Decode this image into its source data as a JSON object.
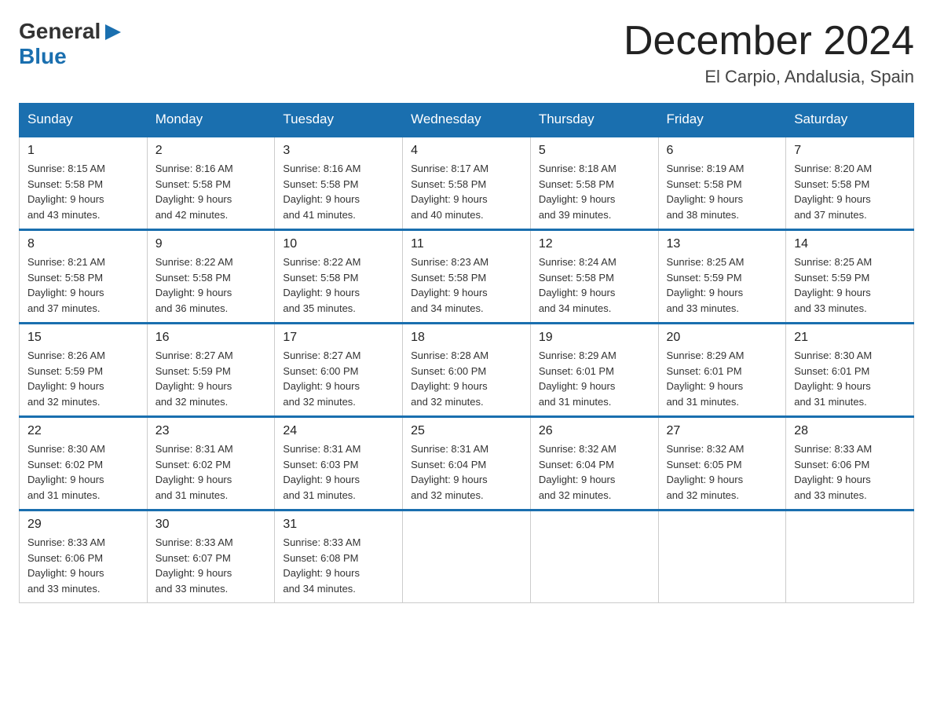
{
  "logo": {
    "general": "General",
    "blue": "Blue"
  },
  "title": {
    "month_year": "December 2024",
    "location": "El Carpio, Andalusia, Spain"
  },
  "headers": [
    "Sunday",
    "Monday",
    "Tuesday",
    "Wednesday",
    "Thursday",
    "Friday",
    "Saturday"
  ],
  "weeks": [
    [
      {
        "day": "1",
        "sunrise": "8:15 AM",
        "sunset": "5:58 PM",
        "daylight": "9 hours and 43 minutes."
      },
      {
        "day": "2",
        "sunrise": "8:16 AM",
        "sunset": "5:58 PM",
        "daylight": "9 hours and 42 minutes."
      },
      {
        "day": "3",
        "sunrise": "8:16 AM",
        "sunset": "5:58 PM",
        "daylight": "9 hours and 41 minutes."
      },
      {
        "day": "4",
        "sunrise": "8:17 AM",
        "sunset": "5:58 PM",
        "daylight": "9 hours and 40 minutes."
      },
      {
        "day": "5",
        "sunrise": "8:18 AM",
        "sunset": "5:58 PM",
        "daylight": "9 hours and 39 minutes."
      },
      {
        "day": "6",
        "sunrise": "8:19 AM",
        "sunset": "5:58 PM",
        "daylight": "9 hours and 38 minutes."
      },
      {
        "day": "7",
        "sunrise": "8:20 AM",
        "sunset": "5:58 PM",
        "daylight": "9 hours and 37 minutes."
      }
    ],
    [
      {
        "day": "8",
        "sunrise": "8:21 AM",
        "sunset": "5:58 PM",
        "daylight": "9 hours and 37 minutes."
      },
      {
        "day": "9",
        "sunrise": "8:22 AM",
        "sunset": "5:58 PM",
        "daylight": "9 hours and 36 minutes."
      },
      {
        "day": "10",
        "sunrise": "8:22 AM",
        "sunset": "5:58 PM",
        "daylight": "9 hours and 35 minutes."
      },
      {
        "day": "11",
        "sunrise": "8:23 AM",
        "sunset": "5:58 PM",
        "daylight": "9 hours and 34 minutes."
      },
      {
        "day": "12",
        "sunrise": "8:24 AM",
        "sunset": "5:58 PM",
        "daylight": "9 hours and 34 minutes."
      },
      {
        "day": "13",
        "sunrise": "8:25 AM",
        "sunset": "5:59 PM",
        "daylight": "9 hours and 33 minutes."
      },
      {
        "day": "14",
        "sunrise": "8:25 AM",
        "sunset": "5:59 PM",
        "daylight": "9 hours and 33 minutes."
      }
    ],
    [
      {
        "day": "15",
        "sunrise": "8:26 AM",
        "sunset": "5:59 PM",
        "daylight": "9 hours and 32 minutes."
      },
      {
        "day": "16",
        "sunrise": "8:27 AM",
        "sunset": "5:59 PM",
        "daylight": "9 hours and 32 minutes."
      },
      {
        "day": "17",
        "sunrise": "8:27 AM",
        "sunset": "6:00 PM",
        "daylight": "9 hours and 32 minutes."
      },
      {
        "day": "18",
        "sunrise": "8:28 AM",
        "sunset": "6:00 PM",
        "daylight": "9 hours and 32 minutes."
      },
      {
        "day": "19",
        "sunrise": "8:29 AM",
        "sunset": "6:01 PM",
        "daylight": "9 hours and 31 minutes."
      },
      {
        "day": "20",
        "sunrise": "8:29 AM",
        "sunset": "6:01 PM",
        "daylight": "9 hours and 31 minutes."
      },
      {
        "day": "21",
        "sunrise": "8:30 AM",
        "sunset": "6:01 PM",
        "daylight": "9 hours and 31 minutes."
      }
    ],
    [
      {
        "day": "22",
        "sunrise": "8:30 AM",
        "sunset": "6:02 PM",
        "daylight": "9 hours and 31 minutes."
      },
      {
        "day": "23",
        "sunrise": "8:31 AM",
        "sunset": "6:02 PM",
        "daylight": "9 hours and 31 minutes."
      },
      {
        "day": "24",
        "sunrise": "8:31 AM",
        "sunset": "6:03 PM",
        "daylight": "9 hours and 31 minutes."
      },
      {
        "day": "25",
        "sunrise": "8:31 AM",
        "sunset": "6:04 PM",
        "daylight": "9 hours and 32 minutes."
      },
      {
        "day": "26",
        "sunrise": "8:32 AM",
        "sunset": "6:04 PM",
        "daylight": "9 hours and 32 minutes."
      },
      {
        "day": "27",
        "sunrise": "8:32 AM",
        "sunset": "6:05 PM",
        "daylight": "9 hours and 32 minutes."
      },
      {
        "day": "28",
        "sunrise": "8:33 AM",
        "sunset": "6:06 PM",
        "daylight": "9 hours and 33 minutes."
      }
    ],
    [
      {
        "day": "29",
        "sunrise": "8:33 AM",
        "sunset": "6:06 PM",
        "daylight": "9 hours and 33 minutes."
      },
      {
        "day": "30",
        "sunrise": "8:33 AM",
        "sunset": "6:07 PM",
        "daylight": "9 hours and 33 minutes."
      },
      {
        "day": "31",
        "sunrise": "8:33 AM",
        "sunset": "6:08 PM",
        "daylight": "9 hours and 34 minutes."
      },
      null,
      null,
      null,
      null
    ]
  ],
  "labels": {
    "sunrise": "Sunrise:",
    "sunset": "Sunset:",
    "daylight": "Daylight:"
  }
}
